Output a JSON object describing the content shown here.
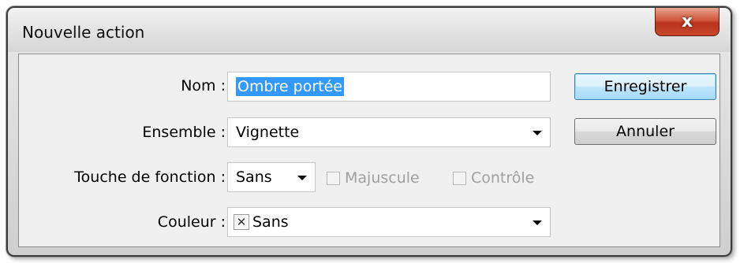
{
  "window": {
    "title": "Nouvelle action",
    "close_glyph": "x"
  },
  "form": {
    "nom_label": "Nom :",
    "nom_value": "Ombre portée",
    "ensemble_label": "Ensemble :",
    "ensemble_value": "Vignette",
    "touche_label": "Touche de fonction :",
    "touche_value": "Sans",
    "majuscule_label": "Majuscule",
    "controle_label": "Contrôle",
    "couleur_label": "Couleur :",
    "couleur_value": "Sans",
    "couleur_swatch_glyph": "✕"
  },
  "buttons": {
    "enregistrer": "Enregistrer",
    "annuler": "Annuler"
  },
  "colors": {
    "selection": "#3399ff",
    "close_button": "#c8482b",
    "default_button_border": "#3c7fb1"
  },
  "icons": {
    "close": "close-icon",
    "dropdown": "chevron-down-icon",
    "color_swatch": "x-swatch-icon"
  }
}
